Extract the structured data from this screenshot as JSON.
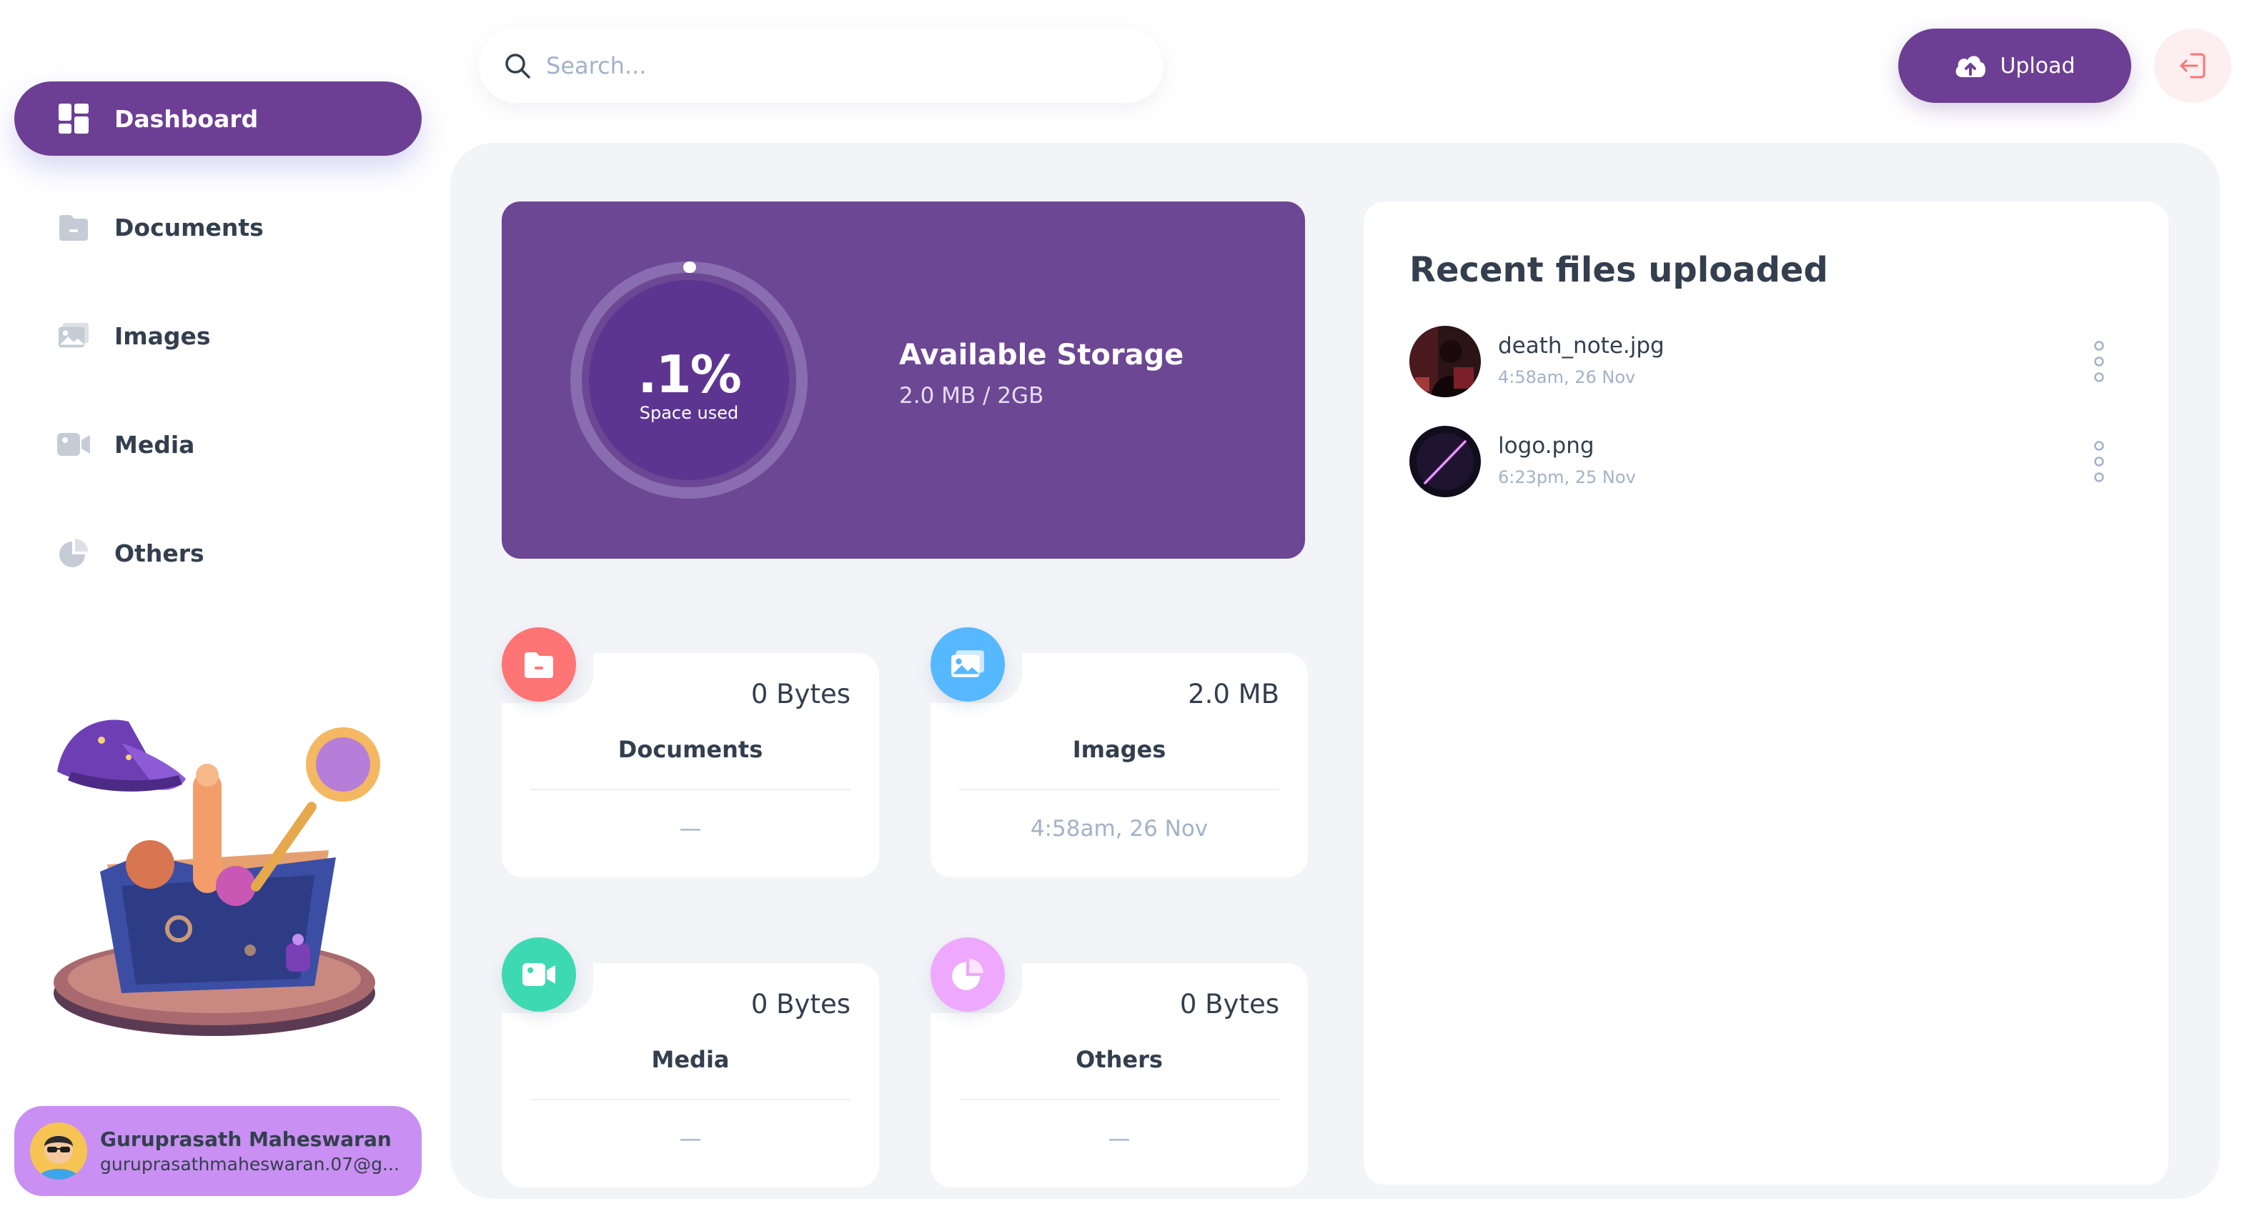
{
  "sidebar": {
    "items": [
      {
        "label": "Dashboard",
        "icon": "dashboard-icon",
        "active": true
      },
      {
        "label": "Documents",
        "icon": "documents-icon",
        "active": false
      },
      {
        "label": "Images",
        "icon": "images-icon",
        "active": false
      },
      {
        "label": "Media",
        "icon": "media-icon",
        "active": false
      },
      {
        "label": "Others",
        "icon": "others-icon",
        "active": false
      }
    ],
    "user": {
      "name": "Guruprasath Maheswaran",
      "email": "guruprasathmaheswaran.07@g..."
    }
  },
  "header": {
    "search_placeholder": "Search...",
    "upload_label": "Upload"
  },
  "storage": {
    "percent_label": ".1%",
    "percent_value": 0.1,
    "caption": "Space used",
    "title": "Available Storage",
    "usage": "2.0 MB / 2GB"
  },
  "summary": [
    {
      "label": "Documents",
      "size": "0 Bytes",
      "updated": "—",
      "color": "#ff7474"
    },
    {
      "label": "Images",
      "size": "2.0 MB",
      "updated": "4:58am, 26 Nov",
      "color": "#56b8ff"
    },
    {
      "label": "Media",
      "size": "0 Bytes",
      "updated": "—",
      "color": "#3dd9b3"
    },
    {
      "label": "Others",
      "size": "0 Bytes",
      "updated": "—",
      "color": "#eea8fd"
    }
  ],
  "recent": {
    "title": "Recent files uploaded",
    "files": [
      {
        "name": "death_note.jpg",
        "date": "4:58am, 26 Nov"
      },
      {
        "name": "logo.png",
        "date": "6:23pm, 25 Nov"
      }
    ]
  },
  "colors": {
    "brand": "#6c3f94",
    "background": "#f2f4f8",
    "text": "#333f4e",
    "muted": "#a3b2c7"
  }
}
